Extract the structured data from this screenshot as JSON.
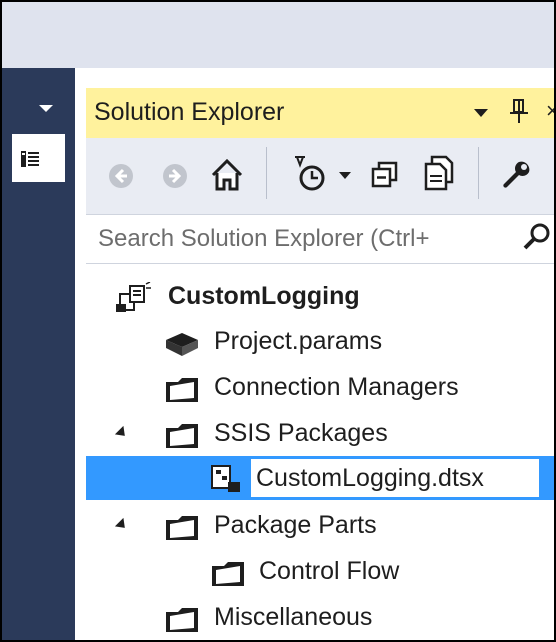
{
  "panel": {
    "title": "Solution Explorer",
    "close_glyph": "×"
  },
  "search": {
    "placeholder": "Search Solution Explorer (Ctrl+"
  },
  "toolbar": {
    "icons": [
      "back-icon",
      "forward-icon",
      "home-icon",
      "pending-changes-filter-icon",
      "dropdown-arrow-icon",
      "collapse-all-icon",
      "show-all-files-icon",
      "properties-wrench-icon"
    ]
  },
  "tree": {
    "project": "CustomLogging",
    "items": [
      {
        "label": "Project.params",
        "icon": "params-icon"
      },
      {
        "label": "Connection Managers",
        "icon": "folder-icon"
      },
      {
        "label": "SSIS Packages",
        "icon": "folder-icon",
        "expanded": true
      },
      {
        "label": "CustomLogging.dtsx",
        "icon": "package-icon",
        "selected": true,
        "editing": true
      },
      {
        "label": "Package Parts",
        "icon": "folder-icon",
        "expanded": true
      },
      {
        "label": "Control Flow",
        "icon": "folder-icon"
      },
      {
        "label": "Miscellaneous",
        "icon": "folder-icon"
      }
    ]
  },
  "colors": {
    "title_bar": "#fff29d",
    "toolbar": "#e9ecf3",
    "left_strip": "#2b3a5a",
    "selection": "#3399ff",
    "top_band": "#dfe3ee"
  }
}
